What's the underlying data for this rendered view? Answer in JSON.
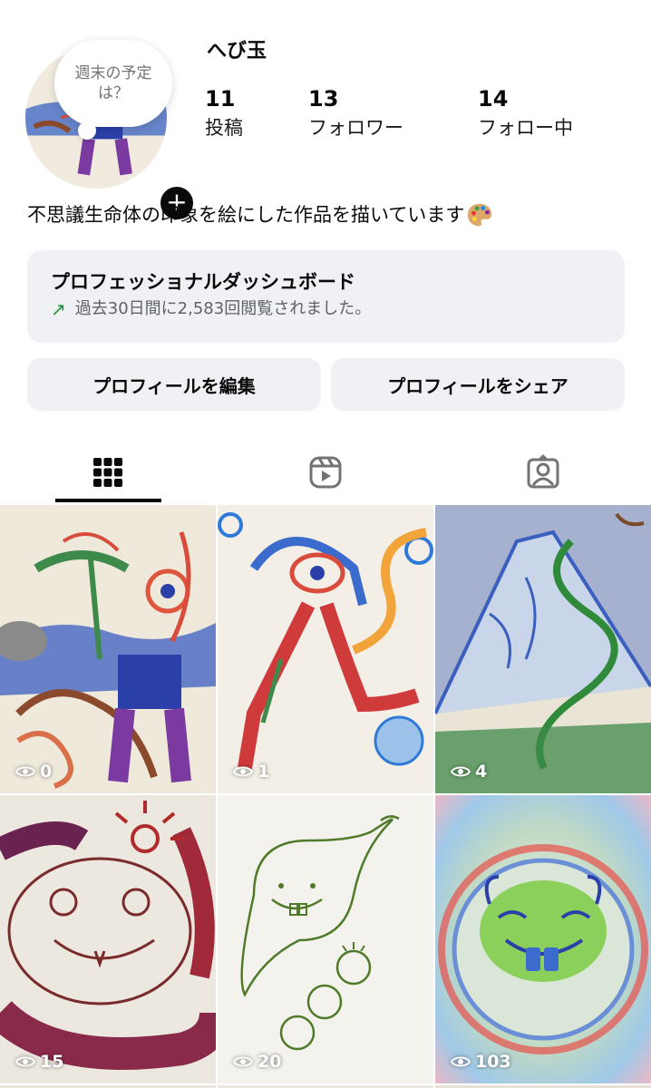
{
  "profile": {
    "note": "週末の予定は？",
    "username": "へび玉",
    "stats": [
      {
        "value": "11",
        "label": "投稿"
      },
      {
        "value": "13",
        "label": "フォロワー"
      },
      {
        "value": "14",
        "label": "フォロー中"
      }
    ],
    "bio": "不思議生命体の印象を絵にした作品を描いています",
    "bio_emoji": "palette-icon"
  },
  "dashboard": {
    "title": "プロフェッショナルダッシュボード",
    "subtitle": "過去30日間に2,583回閲覧されました。",
    "trend_icon": "trending-up-icon",
    "trend_color": "#1f8f3a"
  },
  "actions": {
    "edit_label": "プロフィールを編集",
    "share_label": "プロフィールをシェア"
  },
  "tabs": [
    {
      "name": "posts",
      "icon": "grid-icon",
      "active": true
    },
    {
      "name": "reels",
      "icon": "reels-icon",
      "active": false
    },
    {
      "name": "tagged",
      "icon": "tagged-icon",
      "active": false
    }
  ],
  "posts": [
    {
      "views": "0",
      "icon": "eye-icon"
    },
    {
      "views": "1",
      "icon": "eye-icon"
    },
    {
      "views": "4",
      "icon": "eye-icon"
    },
    {
      "views": "15",
      "icon": "eye-icon"
    },
    {
      "views": "20",
      "icon": "eye-icon"
    },
    {
      "views": "103",
      "icon": "eye-icon"
    }
  ],
  "colors": {
    "background": "#ffffff",
    "card_background": "#eff1f4",
    "text": "#0a0a0a",
    "muted_text": "#5f6368"
  }
}
